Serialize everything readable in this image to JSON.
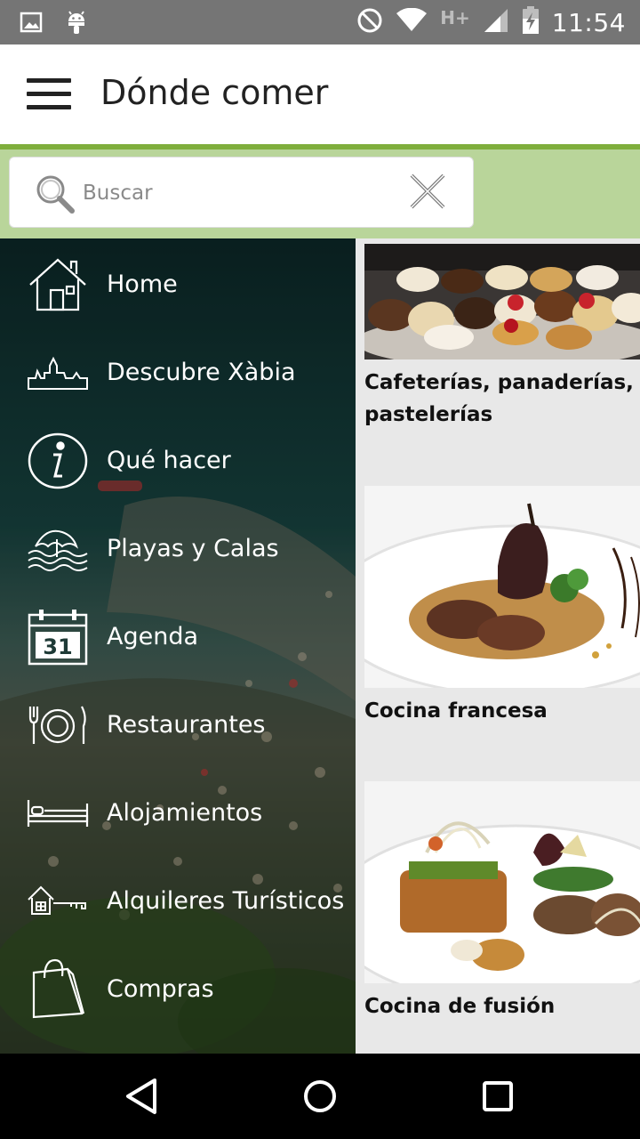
{
  "status_bar": {
    "time": "11:54",
    "network": "H+",
    "icons": [
      "image-icon",
      "android-icon",
      "do-not-disturb-icon",
      "wifi-icon",
      "signal-icon",
      "battery-charging-icon"
    ]
  },
  "toolbar": {
    "title": "Dónde comer",
    "menu_icon": "hamburger-menu-icon"
  },
  "search": {
    "placeholder": "Buscar",
    "value": ""
  },
  "drawer": {
    "items": [
      {
        "label": "Home",
        "icon": "house-icon"
      },
      {
        "label": "Descubre Xàbia",
        "icon": "town-skyline-icon"
      },
      {
        "label": "Qué hacer",
        "icon": "info-icon"
      },
      {
        "label": "Playas y Calas",
        "icon": "beach-umbrella-icon"
      },
      {
        "label": "Agenda",
        "icon": "calendar-icon",
        "calendar_day": "31"
      },
      {
        "label": "Restaurantes",
        "icon": "fork-plate-knife-icon"
      },
      {
        "label": "Alojamientos",
        "icon": "bed-icon"
      },
      {
        "label": "Alquileres Turísticos",
        "icon": "house-key-icon"
      },
      {
        "label": "Compras",
        "icon": "shopping-bag-icon"
      }
    ]
  },
  "cards": [
    {
      "title": "Cafeterías, panaderías, pastelerías",
      "image": "pastries-photo"
    },
    {
      "title": "Cocina francesa",
      "image": "french-dish-photo"
    },
    {
      "title": "Cocina de fusión",
      "image": "fusion-dish-photo"
    }
  ],
  "colors": {
    "status_bar": "#757575",
    "toolbar_accent": "#7fae3c",
    "search_band": "#b9d59a"
  },
  "nav_bar": {
    "icons": [
      "back-icon",
      "home-icon",
      "recents-icon"
    ]
  }
}
